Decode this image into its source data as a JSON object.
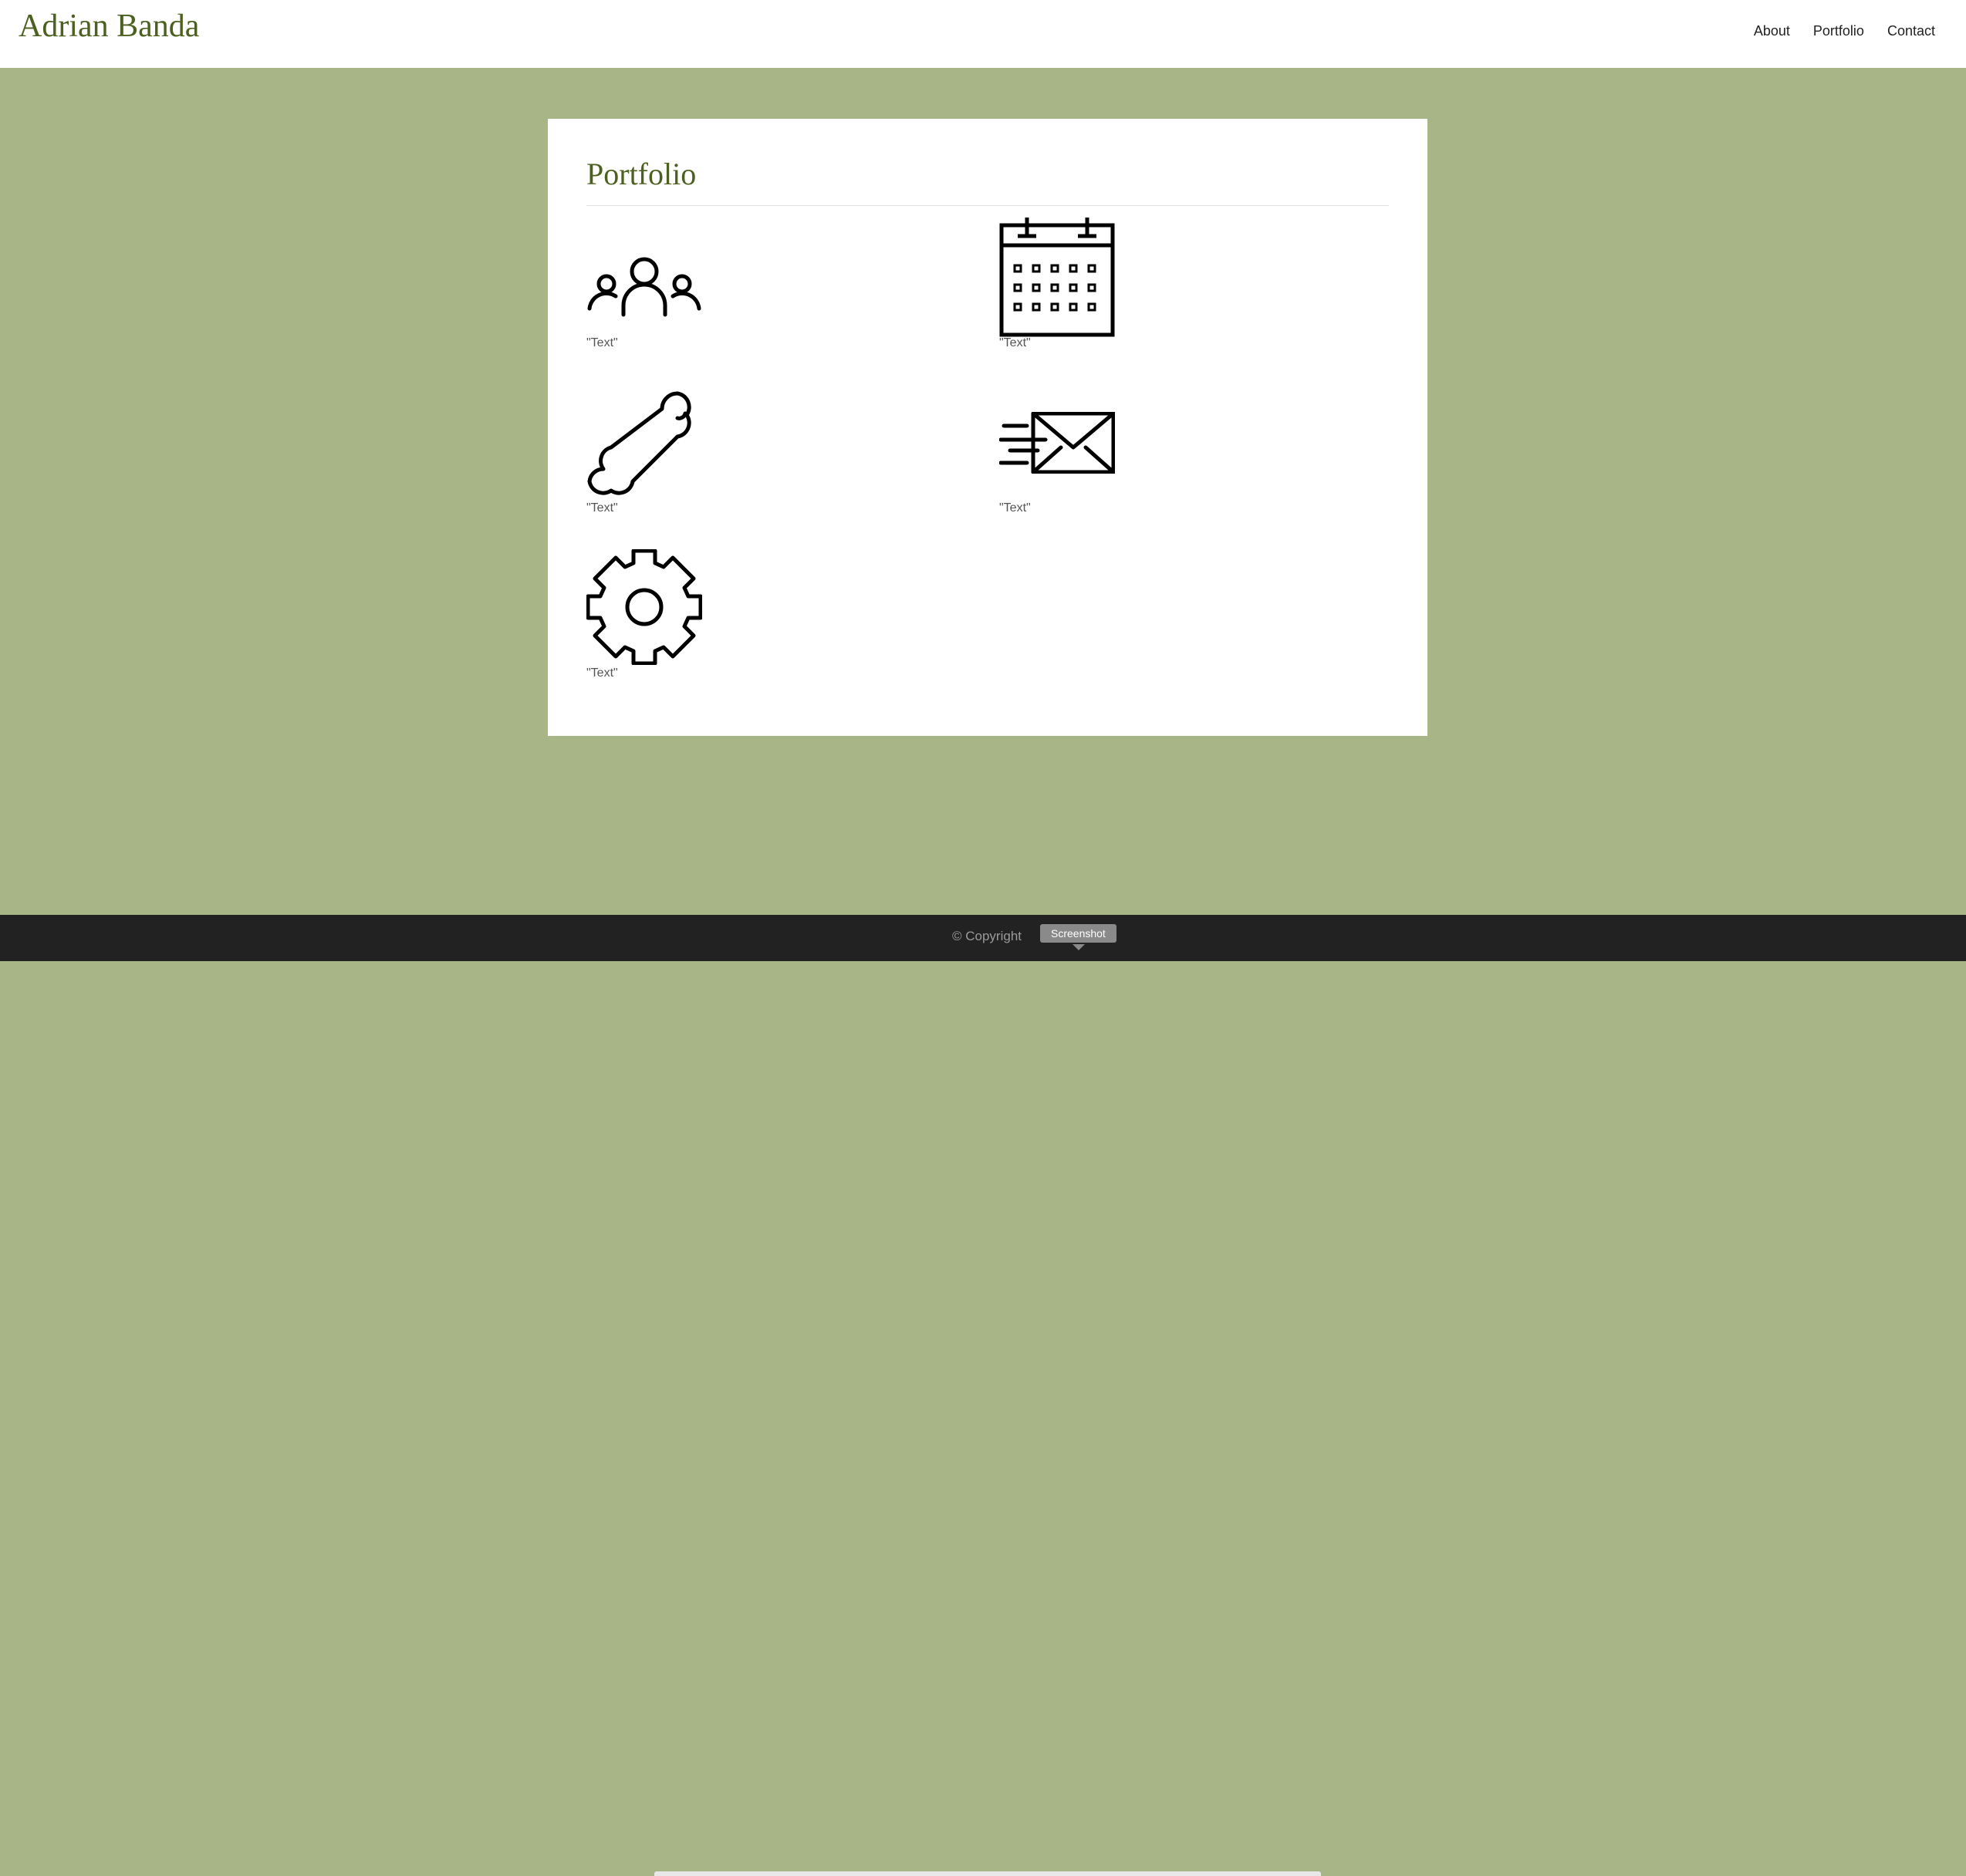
{
  "navbar": {
    "brand": "Adrian Banda",
    "links": [
      {
        "label": "About"
      },
      {
        "label": "Portfolio"
      },
      {
        "label": "Contact"
      }
    ]
  },
  "main": {
    "title": "Portfolio",
    "items": [
      {
        "icon": "users-group-icon",
        "caption": "\"Text\""
      },
      {
        "icon": "calendar-icon",
        "caption": "\"Text\""
      },
      {
        "icon": "bone-icon",
        "caption": "\"Text\""
      },
      {
        "icon": "fast-mail-icon",
        "caption": "\"Text\""
      },
      {
        "icon": "gear-icon",
        "caption": "\"Text\""
      }
    ]
  },
  "footer": {
    "copyright": "© Copyright",
    "tooltip": "Screenshot"
  },
  "colors": {
    "background": "#a7b587",
    "brand": "#4c6020",
    "footer": "#222222"
  }
}
